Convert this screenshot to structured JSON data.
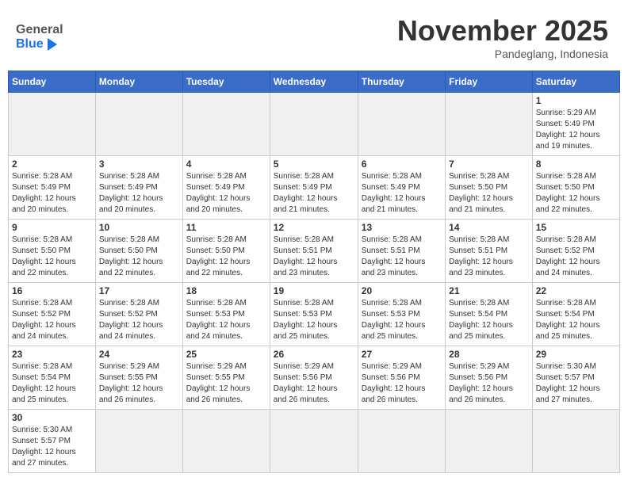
{
  "header": {
    "logo_general": "General",
    "logo_blue": "Blue",
    "month_title": "November 2025",
    "location": "Pandeglang, Indonesia"
  },
  "weekdays": [
    "Sunday",
    "Monday",
    "Tuesday",
    "Wednesday",
    "Thursday",
    "Friday",
    "Saturday"
  ],
  "weeks": [
    [
      {
        "day": "",
        "info": ""
      },
      {
        "day": "",
        "info": ""
      },
      {
        "day": "",
        "info": ""
      },
      {
        "day": "",
        "info": ""
      },
      {
        "day": "",
        "info": ""
      },
      {
        "day": "",
        "info": ""
      },
      {
        "day": "1",
        "info": "Sunrise: 5:29 AM\nSunset: 5:49 PM\nDaylight: 12 hours\nand 19 minutes."
      }
    ],
    [
      {
        "day": "2",
        "info": "Sunrise: 5:28 AM\nSunset: 5:49 PM\nDaylight: 12 hours\nand 20 minutes."
      },
      {
        "day": "3",
        "info": "Sunrise: 5:28 AM\nSunset: 5:49 PM\nDaylight: 12 hours\nand 20 minutes."
      },
      {
        "day": "4",
        "info": "Sunrise: 5:28 AM\nSunset: 5:49 PM\nDaylight: 12 hours\nand 20 minutes."
      },
      {
        "day": "5",
        "info": "Sunrise: 5:28 AM\nSunset: 5:49 PM\nDaylight: 12 hours\nand 21 minutes."
      },
      {
        "day": "6",
        "info": "Sunrise: 5:28 AM\nSunset: 5:49 PM\nDaylight: 12 hours\nand 21 minutes."
      },
      {
        "day": "7",
        "info": "Sunrise: 5:28 AM\nSunset: 5:50 PM\nDaylight: 12 hours\nand 21 minutes."
      },
      {
        "day": "8",
        "info": "Sunrise: 5:28 AM\nSunset: 5:50 PM\nDaylight: 12 hours\nand 22 minutes."
      }
    ],
    [
      {
        "day": "9",
        "info": "Sunrise: 5:28 AM\nSunset: 5:50 PM\nDaylight: 12 hours\nand 22 minutes."
      },
      {
        "day": "10",
        "info": "Sunrise: 5:28 AM\nSunset: 5:50 PM\nDaylight: 12 hours\nand 22 minutes."
      },
      {
        "day": "11",
        "info": "Sunrise: 5:28 AM\nSunset: 5:50 PM\nDaylight: 12 hours\nand 22 minutes."
      },
      {
        "day": "12",
        "info": "Sunrise: 5:28 AM\nSunset: 5:51 PM\nDaylight: 12 hours\nand 23 minutes."
      },
      {
        "day": "13",
        "info": "Sunrise: 5:28 AM\nSunset: 5:51 PM\nDaylight: 12 hours\nand 23 minutes."
      },
      {
        "day": "14",
        "info": "Sunrise: 5:28 AM\nSunset: 5:51 PM\nDaylight: 12 hours\nand 23 minutes."
      },
      {
        "day": "15",
        "info": "Sunrise: 5:28 AM\nSunset: 5:52 PM\nDaylight: 12 hours\nand 24 minutes."
      }
    ],
    [
      {
        "day": "16",
        "info": "Sunrise: 5:28 AM\nSunset: 5:52 PM\nDaylight: 12 hours\nand 24 minutes."
      },
      {
        "day": "17",
        "info": "Sunrise: 5:28 AM\nSunset: 5:52 PM\nDaylight: 12 hours\nand 24 minutes."
      },
      {
        "day": "18",
        "info": "Sunrise: 5:28 AM\nSunset: 5:53 PM\nDaylight: 12 hours\nand 24 minutes."
      },
      {
        "day": "19",
        "info": "Sunrise: 5:28 AM\nSunset: 5:53 PM\nDaylight: 12 hours\nand 25 minutes."
      },
      {
        "day": "20",
        "info": "Sunrise: 5:28 AM\nSunset: 5:53 PM\nDaylight: 12 hours\nand 25 minutes."
      },
      {
        "day": "21",
        "info": "Sunrise: 5:28 AM\nSunset: 5:54 PM\nDaylight: 12 hours\nand 25 minutes."
      },
      {
        "day": "22",
        "info": "Sunrise: 5:28 AM\nSunset: 5:54 PM\nDaylight: 12 hours\nand 25 minutes."
      }
    ],
    [
      {
        "day": "23",
        "info": "Sunrise: 5:28 AM\nSunset: 5:54 PM\nDaylight: 12 hours\nand 25 minutes."
      },
      {
        "day": "24",
        "info": "Sunrise: 5:29 AM\nSunset: 5:55 PM\nDaylight: 12 hours\nand 26 minutes."
      },
      {
        "day": "25",
        "info": "Sunrise: 5:29 AM\nSunset: 5:55 PM\nDaylight: 12 hours\nand 26 minutes."
      },
      {
        "day": "26",
        "info": "Sunrise: 5:29 AM\nSunset: 5:56 PM\nDaylight: 12 hours\nand 26 minutes."
      },
      {
        "day": "27",
        "info": "Sunrise: 5:29 AM\nSunset: 5:56 PM\nDaylight: 12 hours\nand 26 minutes."
      },
      {
        "day": "28",
        "info": "Sunrise: 5:29 AM\nSunset: 5:56 PM\nDaylight: 12 hours\nand 26 minutes."
      },
      {
        "day": "29",
        "info": "Sunrise: 5:30 AM\nSunset: 5:57 PM\nDaylight: 12 hours\nand 27 minutes."
      }
    ],
    [
      {
        "day": "30",
        "info": "Sunrise: 5:30 AM\nSunset: 5:57 PM\nDaylight: 12 hours\nand 27 minutes."
      },
      {
        "day": "",
        "info": ""
      },
      {
        "day": "",
        "info": ""
      },
      {
        "day": "",
        "info": ""
      },
      {
        "day": "",
        "info": ""
      },
      {
        "day": "",
        "info": ""
      },
      {
        "day": "",
        "info": ""
      }
    ]
  ]
}
